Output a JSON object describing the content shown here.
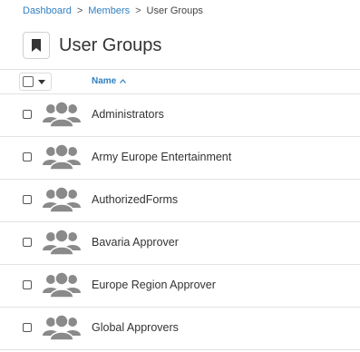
{
  "breadcrumb": {
    "items": [
      "Dashboard",
      "Members"
    ],
    "separator": ">",
    "current": "User Groups"
  },
  "page": {
    "title": "User Groups",
    "icon": "bookmark-icon"
  },
  "table": {
    "header": {
      "name_label": "Name",
      "sort_indicator": "^"
    },
    "rows": [
      {
        "name": "Administrators",
        "icon": "user-group-icon"
      },
      {
        "name": "Army Europe Entertainment",
        "icon": "user-group-icon"
      },
      {
        "name": "AuthorizedForms",
        "icon": "user-group-icon"
      },
      {
        "name": "Bavaria Approver",
        "icon": "user-group-icon"
      },
      {
        "name": "Europe Region Approver",
        "icon": "user-group-icon"
      },
      {
        "name": "Global Approvers",
        "icon": "user-group-icon"
      }
    ]
  },
  "colors": {
    "link": "#2f7fc1",
    "icon_gray": "#888888",
    "divider": "#e2e2e2"
  }
}
